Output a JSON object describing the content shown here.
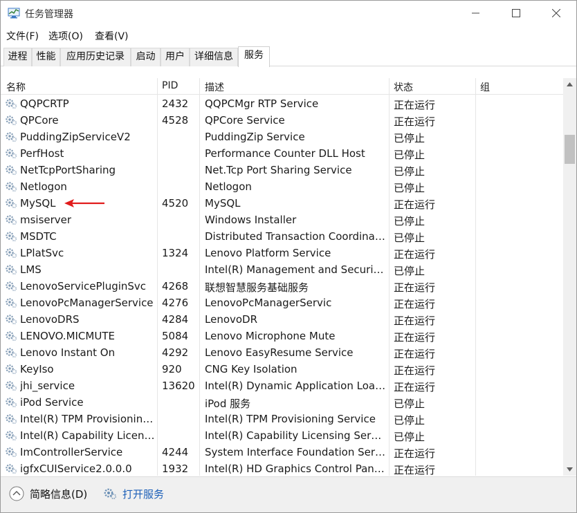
{
  "window": {
    "title": "任务管理器"
  },
  "menu": [
    "文件(F)",
    "选项(O)",
    "查看(V)"
  ],
  "tabs": [
    "进程",
    "性能",
    "应用历史记录",
    "启动",
    "用户",
    "详细信息",
    "服务"
  ],
  "active_tab": "服务",
  "columns": {
    "name": "名称",
    "pid": "PID",
    "desc": "描述",
    "state": "状态",
    "group": "组"
  },
  "services": [
    {
      "name": "QQPCRTP",
      "pid": "2432",
      "desc": "QQPCMgr RTP Service",
      "state": "正在运行"
    },
    {
      "name": "QPCore",
      "pid": "4528",
      "desc": "QPCore Service",
      "state": "正在运行"
    },
    {
      "name": "PuddingZipServiceV2",
      "pid": "",
      "desc": "PuddingZip Service",
      "state": "已停止"
    },
    {
      "name": "PerfHost",
      "pid": "",
      "desc": "Performance Counter DLL Host",
      "state": "已停止"
    },
    {
      "name": "NetTcpPortSharing",
      "pid": "",
      "desc": "Net.Tcp Port Sharing Service",
      "state": "已停止"
    },
    {
      "name": "Netlogon",
      "pid": "",
      "desc": "Netlogon",
      "state": "已停止"
    },
    {
      "name": "MySQL",
      "pid": "4520",
      "desc": "MySQL",
      "state": "正在运行"
    },
    {
      "name": "msiserver",
      "pid": "",
      "desc": "Windows Installer",
      "state": "已停止"
    },
    {
      "name": "MSDTC",
      "pid": "",
      "desc": "Distributed Transaction Coordinat...",
      "state": "已停止"
    },
    {
      "name": "LPlatSvc",
      "pid": "1324",
      "desc": "Lenovo Platform Service",
      "state": "正在运行"
    },
    {
      "name": "LMS",
      "pid": "",
      "desc": "Intel(R) Management and Security...",
      "state": "已停止"
    },
    {
      "name": "LenovoServicePluginSvc",
      "pid": "4268",
      "desc": "联想智慧服务基础服务",
      "state": "正在运行"
    },
    {
      "name": "LenovoPcManagerService",
      "pid": "4276",
      "desc": "LenovoPcManagerServic",
      "state": "正在运行"
    },
    {
      "name": "LenovoDRS",
      "pid": "4284",
      "desc": "LenovoDR",
      "state": "正在运行"
    },
    {
      "name": "LENOVO.MICMUTE",
      "pid": "5084",
      "desc": "Lenovo Microphone Mute",
      "state": "正在运行"
    },
    {
      "name": "Lenovo Instant On",
      "pid": "4292",
      "desc": "Lenovo EasyResume Service",
      "state": "正在运行"
    },
    {
      "name": "KeyIso",
      "pid": "920",
      "desc": "CNG Key Isolation",
      "state": "正在运行"
    },
    {
      "name": "jhi_service",
      "pid": "13620",
      "desc": "Intel(R) Dynamic Application Load...",
      "state": "正在运行"
    },
    {
      "name": "iPod Service",
      "pid": "",
      "desc": "iPod 服务",
      "state": "已停止"
    },
    {
      "name": "Intel(R) TPM Provisioning...",
      "pid": "",
      "desc": "Intel(R) TPM Provisioning Service",
      "state": "已停止"
    },
    {
      "name": "Intel(R) Capability Licensi...",
      "pid": "",
      "desc": "Intel(R) Capability Licensing Servi...",
      "state": "已停止"
    },
    {
      "name": "ImControllerService",
      "pid": "4244",
      "desc": "System Interface Foundation Serv...",
      "state": "正在运行"
    },
    {
      "name": "igfxCUIService2.0.0.0",
      "pid": "1932",
      "desc": "Intel(R) HD Graphics Control Pane...",
      "state": "正在运行"
    }
  ],
  "footer": {
    "fewer_details": "简略信息(D)",
    "open_services": "打开服务"
  },
  "colors": {
    "arrow": "#e11b1b",
    "link": "#1c5fb8",
    "tab_bg": "#f0f0f0"
  },
  "icons": [
    "task-manager-icon",
    "minimize-icon",
    "maximize-icon",
    "close-icon",
    "gear-icon",
    "chevron-up-icon",
    "chevron-down-icon",
    "red-arrow-icon"
  ]
}
